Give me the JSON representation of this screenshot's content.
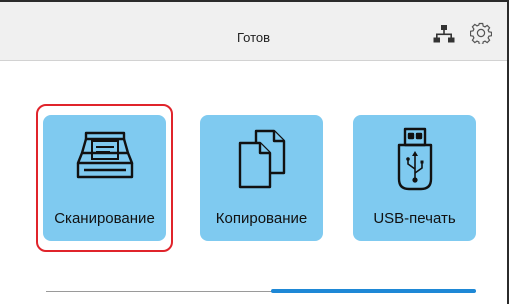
{
  "header": {
    "status": "Готов",
    "network_icon": "network-icon",
    "settings_icon": "gear-icon"
  },
  "tiles": [
    {
      "label": "Сканирование",
      "icon": "scanner-icon",
      "selected": true
    },
    {
      "label": "Копирование",
      "icon": "copy-documents-icon",
      "selected": false
    },
    {
      "label": "USB-печать",
      "icon": "usb-drive-icon",
      "selected": false
    }
  ],
  "pager": {
    "current_page": 2,
    "total_pages": 2
  },
  "colors": {
    "tile": "#7fcaf0",
    "selection": "#e0242b",
    "page_indicator": "#1e88d6",
    "header": "#f0f0f0"
  }
}
